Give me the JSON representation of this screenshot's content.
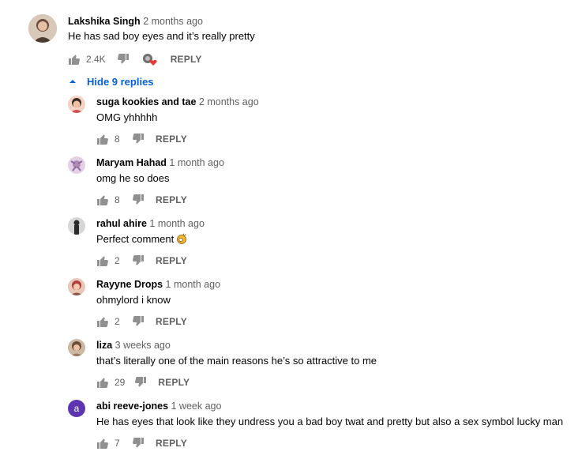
{
  "top_comment": {
    "author": "Lakshika Singh",
    "time": "2 months ago",
    "text": "He has sad boy eyes and it’s really pretty",
    "likes": "2.4K",
    "reply_label": "REPLY",
    "avatar_color": "#c9b7a6"
  },
  "hide_replies_label": "Hide 9 replies",
  "accent_color": "#065fd4",
  "replies": [
    {
      "author": "suga kookies and tae",
      "time": "2 months ago",
      "text": "OMG yhhhhh",
      "likes": "8",
      "reply_label": "REPLY",
      "avatar_color": "#e8b4a8"
    },
    {
      "author": "Maryam Hahad",
      "time": "1 month ago",
      "text": "omg he so does",
      "likes": "8",
      "reply_label": "REPLY",
      "avatar_color": "#c8a3c4"
    },
    {
      "author": "rahul ahire",
      "time": "1 month ago",
      "text": "Perfect comment",
      "likes": "2",
      "reply_label": "REPLY",
      "avatar_color": "#7a7a7a"
    },
    {
      "author": "Rayyne Drops",
      "time": "1 month ago",
      "text": "ohmylord i know",
      "likes": "2",
      "reply_label": "REPLY",
      "avatar_color": "#c98a7a"
    },
    {
      "author": "liza",
      "time": "3 weeks ago",
      "text": "that’s literally one of the main reasons he’s so attractive to me",
      "likes": "29",
      "reply_label": "REPLY",
      "avatar_color": "#b59a83"
    },
    {
      "author": "abi reeve-jones",
      "time": "1 week ago",
      "text": "He has eyes that look like they undress you a bad boy twat and pretty but also a sex symbol lucky man",
      "likes": "7",
      "reply_label": "REPLY",
      "avatar_color": "#5e35b1",
      "avatar_letter": "a"
    }
  ]
}
